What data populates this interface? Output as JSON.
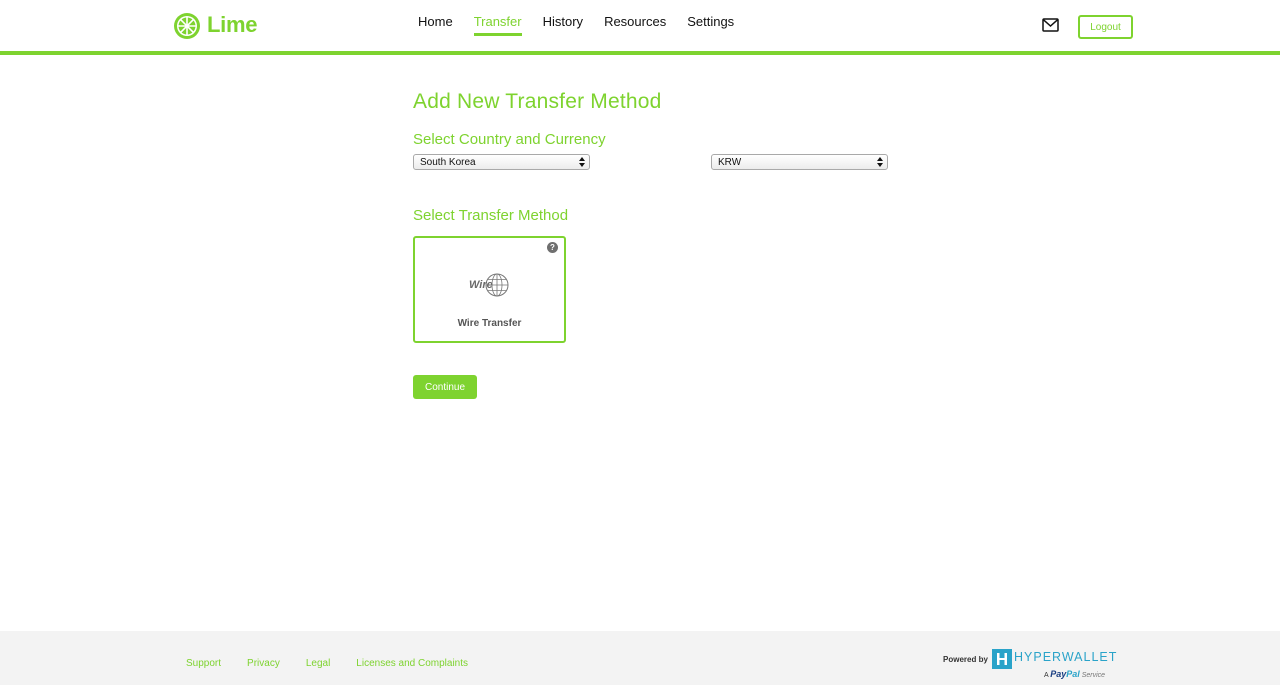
{
  "brand": {
    "name": "Lime",
    "accent_color": "#7ed32f"
  },
  "nav": {
    "items": [
      {
        "label": "Home",
        "active": false
      },
      {
        "label": "Transfer",
        "active": true
      },
      {
        "label": "History",
        "active": false
      },
      {
        "label": "Resources",
        "active": false
      },
      {
        "label": "Settings",
        "active": false
      }
    ]
  },
  "header": {
    "mail_icon": "mail-icon",
    "logout_label": "Logout"
  },
  "main": {
    "page_title": "Add New Transfer Method",
    "country_section_title": "Select Country and Currency",
    "country_selected": "South Korea",
    "currency_selected": "KRW",
    "method_section_title": "Select Transfer Method",
    "method": {
      "logo_text": "Wire",
      "label": "Wire Transfer",
      "help_icon": "question-mark-icon",
      "help_glyph": "?"
    },
    "continue_label": "Continue"
  },
  "footer": {
    "links": [
      "Support",
      "Privacy",
      "Legal",
      "Licenses and Complaints"
    ],
    "powered_by": "Powered by",
    "provider": "HYPERWALLET",
    "tagline_prefix": "A",
    "tagline_pay": "Pay",
    "tagline_pal": "Pal",
    "tagline_suffix": "Service",
    "provider_color": "#2aa3c9"
  }
}
